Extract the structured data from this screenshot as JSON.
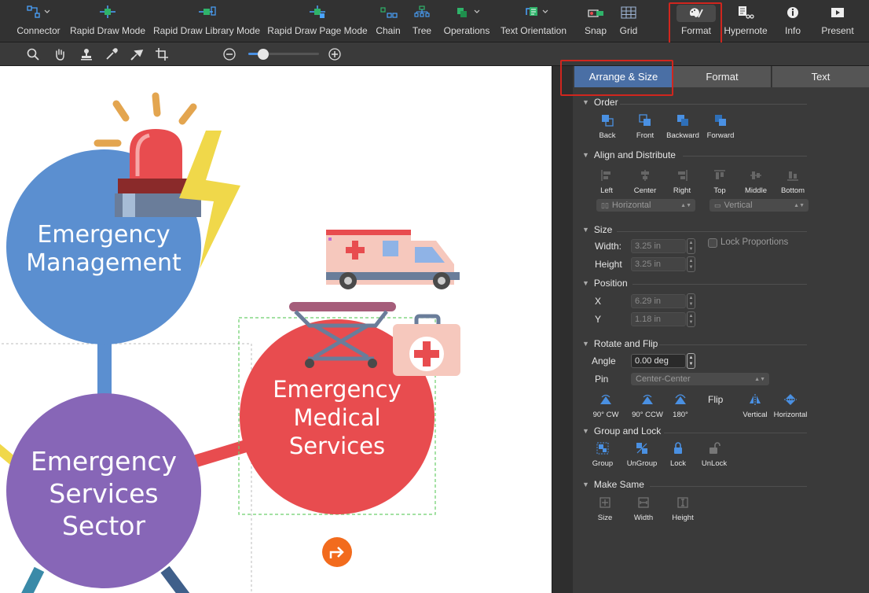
{
  "toolbar": {
    "items": [
      {
        "label": "Connector"
      },
      {
        "label": "Rapid Draw Mode"
      },
      {
        "label": "Rapid Draw Library Mode"
      },
      {
        "label": "Rapid Draw Page Mode"
      },
      {
        "label": "Chain"
      },
      {
        "label": "Tree"
      },
      {
        "label": "Operations"
      },
      {
        "label": "Text Orientation"
      },
      {
        "label": "Snap"
      },
      {
        "label": "Grid"
      },
      {
        "label": "Format"
      },
      {
        "label": "Hypernote"
      },
      {
        "label": "Info"
      },
      {
        "label": "Present"
      }
    ]
  },
  "canvas": {
    "nodes": [
      {
        "line1": "Emergency",
        "line2": "Management"
      },
      {
        "line1": "Emergency",
        "line2": "Services",
        "line3": "Sector"
      },
      {
        "line1": "Emergency",
        "line2": "Medical",
        "line3": "Services"
      }
    ],
    "colors": {
      "management": "#5b8fd0",
      "sector": "#8766b7",
      "medical": "#e84c4f",
      "accent": "#f26b1d"
    }
  },
  "panel": {
    "tabs": [
      {
        "label": "Arrange & Size"
      },
      {
        "label": "Format"
      },
      {
        "label": "Text"
      }
    ],
    "order": {
      "title": "Order",
      "buttons": [
        "Back",
        "Front",
        "Backward",
        "Forward"
      ]
    },
    "align": {
      "title": "Align and Distribute",
      "buttons": [
        "Left",
        "Center",
        "Right",
        "Top",
        "Middle",
        "Bottom"
      ],
      "horizontal": "Horizontal",
      "vertical": "Vertical"
    },
    "size": {
      "title": "Size",
      "width_label": "Width:",
      "width_value": "3.25 in",
      "height_label": "Height",
      "height_value": "3.25 in",
      "lock_label": "Lock Proportions"
    },
    "position": {
      "title": "Position",
      "x_label": "X",
      "x_value": "6.29 in",
      "y_label": "Y",
      "y_value": "1.18 in"
    },
    "rotate": {
      "title": "Rotate and Flip",
      "angle_label": "Angle",
      "angle_value": "0.00 deg",
      "pin_label": "Pin",
      "pin_value": "Center-Center",
      "flip_label": "Flip",
      "buttons": [
        "90° CW",
        "90° CCW",
        "180°"
      ],
      "flip_buttons": [
        "Vertical",
        "Horizontal"
      ]
    },
    "group": {
      "title": "Group and Lock",
      "buttons": [
        "Group",
        "UnGroup",
        "Lock",
        "UnLock"
      ]
    },
    "make_same": {
      "title": "Make Same",
      "buttons": [
        "Size",
        "Width",
        "Height"
      ]
    }
  }
}
